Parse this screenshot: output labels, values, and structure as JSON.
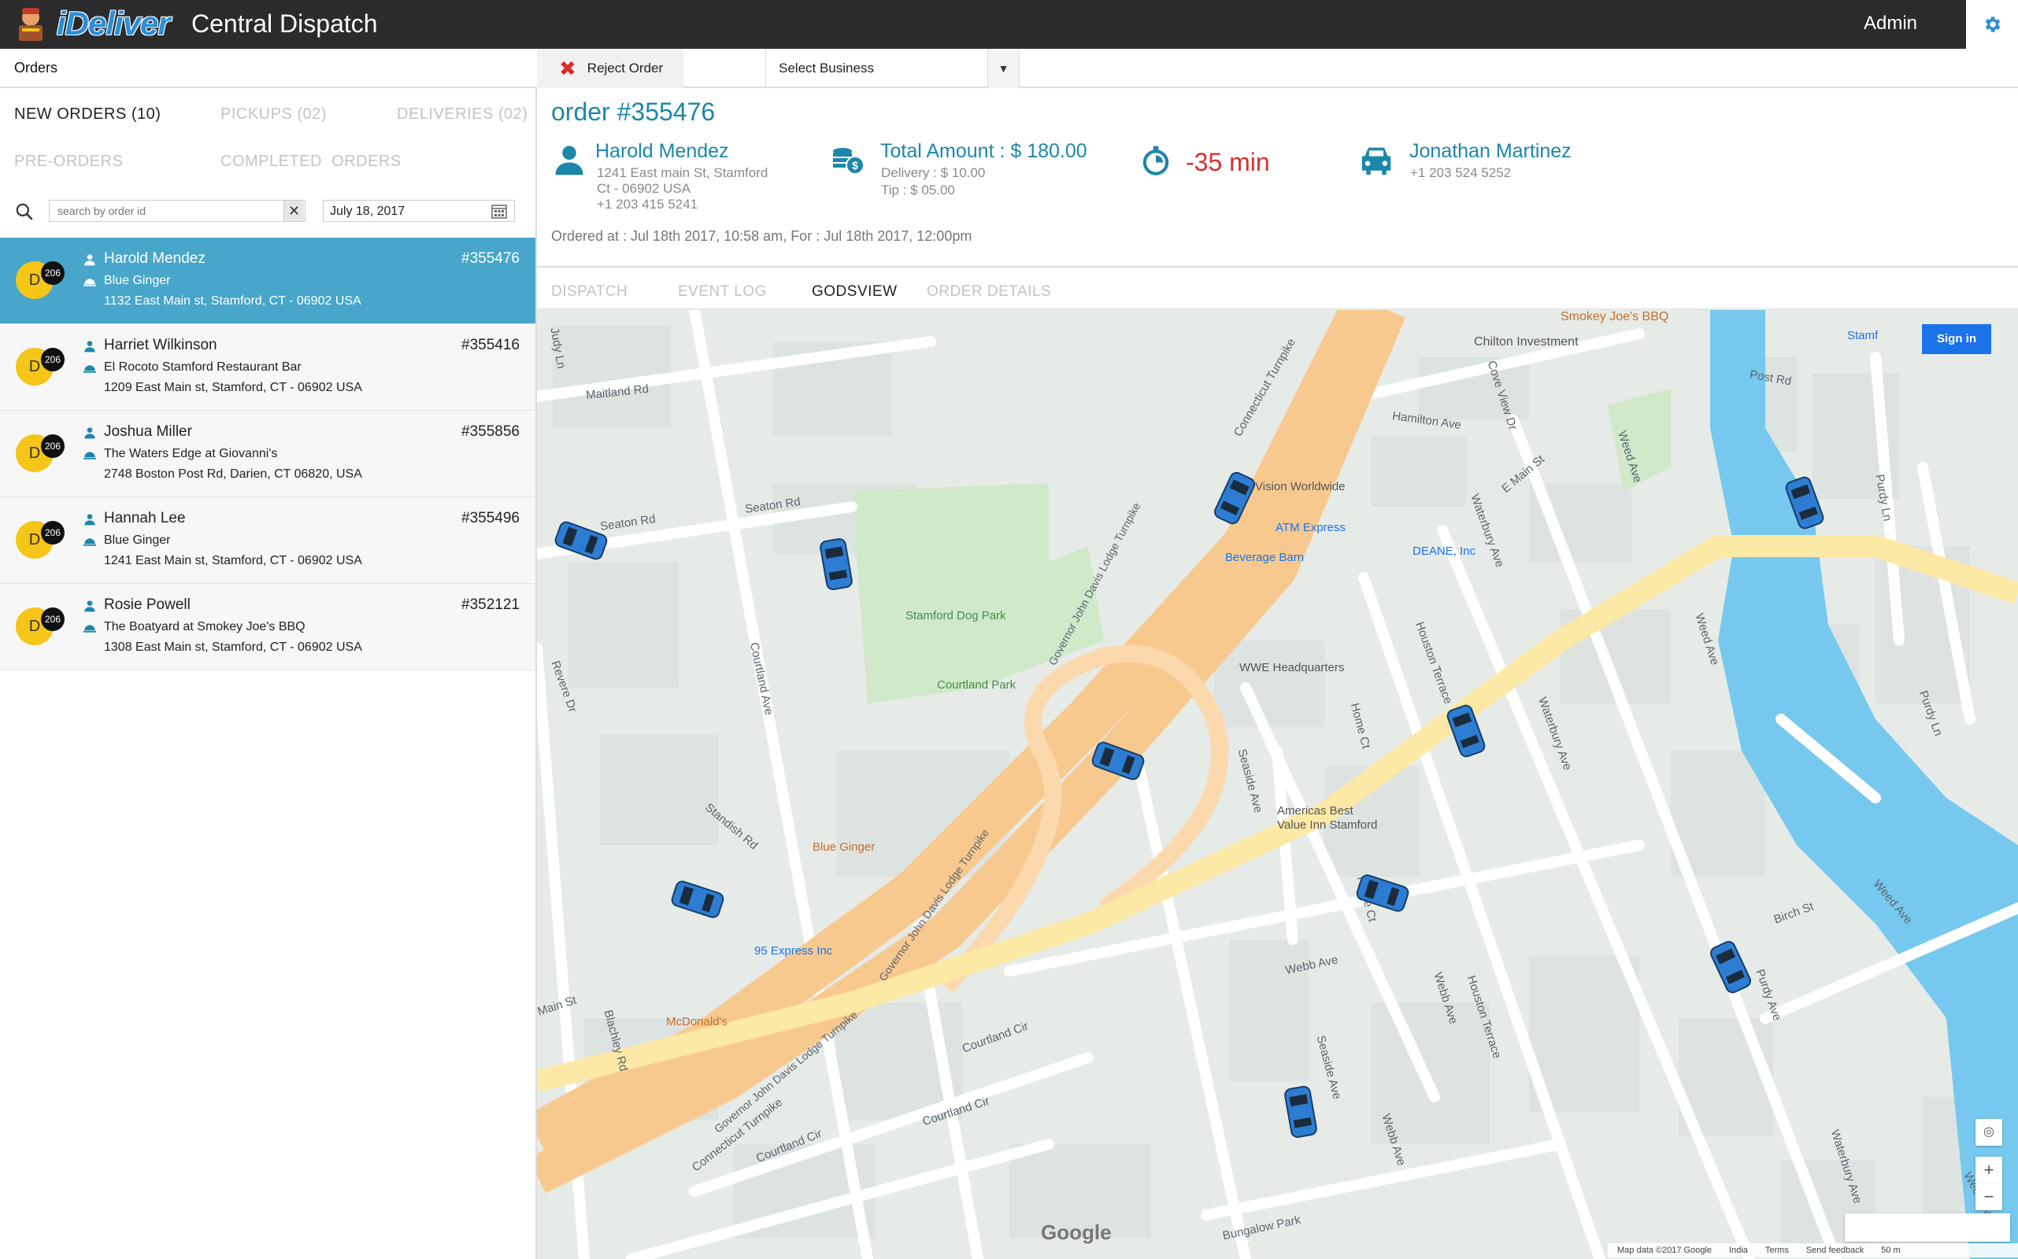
{
  "header": {
    "brand": "iDeliver",
    "title": "Central Dispatch",
    "user": "Admin"
  },
  "toolbar": {
    "orders_label": "Orders",
    "reject_label": "Reject Order",
    "business_select": "Select Business"
  },
  "tabs": {
    "new_orders": "NEW ORDERS (10)",
    "pickups": "PICKUPS (02)",
    "deliveries": "DELIVERIES (02)",
    "pre_orders": "PRE-ORDERS",
    "completed": "COMPLETED  ORDERS"
  },
  "search": {
    "placeholder": "search by order id",
    "date": "July 18, 2017"
  },
  "orders": [
    {
      "avatar": "D",
      "badge": "206",
      "name": "Harold Mendez",
      "business": "Blue Ginger",
      "address": "1132 East Main st, Stamford, CT - 06902 USA",
      "number": "#355476"
    },
    {
      "avatar": "D",
      "badge": "206",
      "name": "Harriet Wilkinson",
      "business": "El Rocoto Stamford Restaurant Bar",
      "address": "1209 East Main st, Stamford, CT - 06902 USA",
      "number": "#355416"
    },
    {
      "avatar": "D",
      "badge": "206",
      "name": "Joshua Miller",
      "business": "The Waters Edge at Giovanni's",
      "address": "2748 Boston Post Rd, Darien, CT 06820, USA",
      "number": "#355856"
    },
    {
      "avatar": "D",
      "badge": "206",
      "name": "Hannah Lee",
      "business": "Blue Ginger",
      "address": "1241 East Main st, Stamford, CT - 06902 USA",
      "number": "#355496"
    },
    {
      "avatar": "D",
      "badge": "206",
      "name": "Rosie Powell",
      "business": "The Boatyard at Smokey Joe's BBQ",
      "address": "1308 East Main st, Stamford, CT - 06902 USA",
      "number": "#352121"
    }
  ],
  "detail": {
    "order_title": "order #355476",
    "customer_name": "Harold Mendez",
    "customer_addr1": "1241 East main St, Stamford",
    "customer_addr2": "Ct - 06902 USA",
    "customer_phone": "+1 203 415 5241",
    "total": "Total Amount : $ 180.00",
    "delivery": "Delivery : $ 10.00",
    "tip": "Tip : $ 05.00",
    "eta": "-35 min",
    "driver_name": "Jonathan Martinez",
    "driver_phone": "+1 203 524 5252",
    "ordered_at": "Ordered at : Jul 18th 2017, 10:58 am, For : Jul 18th 2017, 12:00pm"
  },
  "detail_tabs": {
    "dispatch": "DISPATCH",
    "event_log": "EVENT LOG",
    "godsview": "GODSVIEW",
    "order_details": "ORDER DETAILS"
  },
  "map": {
    "signin": "Sign in",
    "google": "Google",
    "footer": [
      "Map data ©2017 Google",
      "India",
      "Terms",
      "Send feedback",
      "50 m"
    ],
    "labels": {
      "smokey": "Smokey Joe's BBQ",
      "chilton": "Chilton Investment",
      "maitland": "Maitland Rd",
      "seaton1": "Seaton Rd",
      "seaton2": "Seaton Rd",
      "hamilton": "Hamilton Ave",
      "post": "Post Rd",
      "emain": "E Main St",
      "vision": "Vision Worldwide",
      "atm": "ATM Express",
      "beverage": "Beverage Barn",
      "deane": "DEANE, Inc",
      "dogpark": "Stamford Dog Park",
      "courtland_park": "Courtland Park",
      "wwe": "WWE Headquarters",
      "blueginger": "Blue Ginger",
      "express95": "95 Express Inc",
      "mcd": "McDonald's",
      "americas1": "Americas Best",
      "americas2": "Value Inn Stamford",
      "webb": "Webb Ave",
      "birch": "Birch St",
      "weed": "Weed Ave",
      "bungalow": "Bungalow Park",
      "courtland_cir1": "Courtland Cir",
      "courtland_cir2": "Courtland Cir",
      "courtland_cir3": "Courtland Cir",
      "main": "Main St",
      "standish": "Standish Rd",
      "blachley": "Blachley Rd",
      "revere": "Revere Dr",
      "judy": "Judy Ln",
      "courtland_ave": "Courtland Ave",
      "seaside1": "Seaside Ave",
      "seaside2": "Seaside Ave",
      "home_ct": "Home Ct",
      "home_ct2": "Home Ct",
      "houston1": "Houston Terrace",
      "houston2": "Houston Terrace",
      "waterbury1": "Waterbury Ave",
      "waterbury2": "Waterbury Ave",
      "waterbury3": "Waterbury Ave",
      "webb2": "Webb Ave",
      "webb3": "Webb Ave",
      "purdy1": "Purdy Ln",
      "purdy2": "Purdy Ln",
      "purdy3": "Purdy Ave",
      "weed2": "Weed Ave",
      "weed3": "Weed Ave",
      "weed4": "Weed Ave",
      "cove": "Cove View Dr",
      "conn1": "Connecticut Turnpike",
      "conn2": "Connecticut Turnpike",
      "gov1": "Governor John Davis Lodge Turnpike",
      "gov2": "Governor John Davis Lodge Turnpike",
      "gov3": "Governor John Davis Lodge Turnpike",
      "stam": "Stamf"
    }
  }
}
